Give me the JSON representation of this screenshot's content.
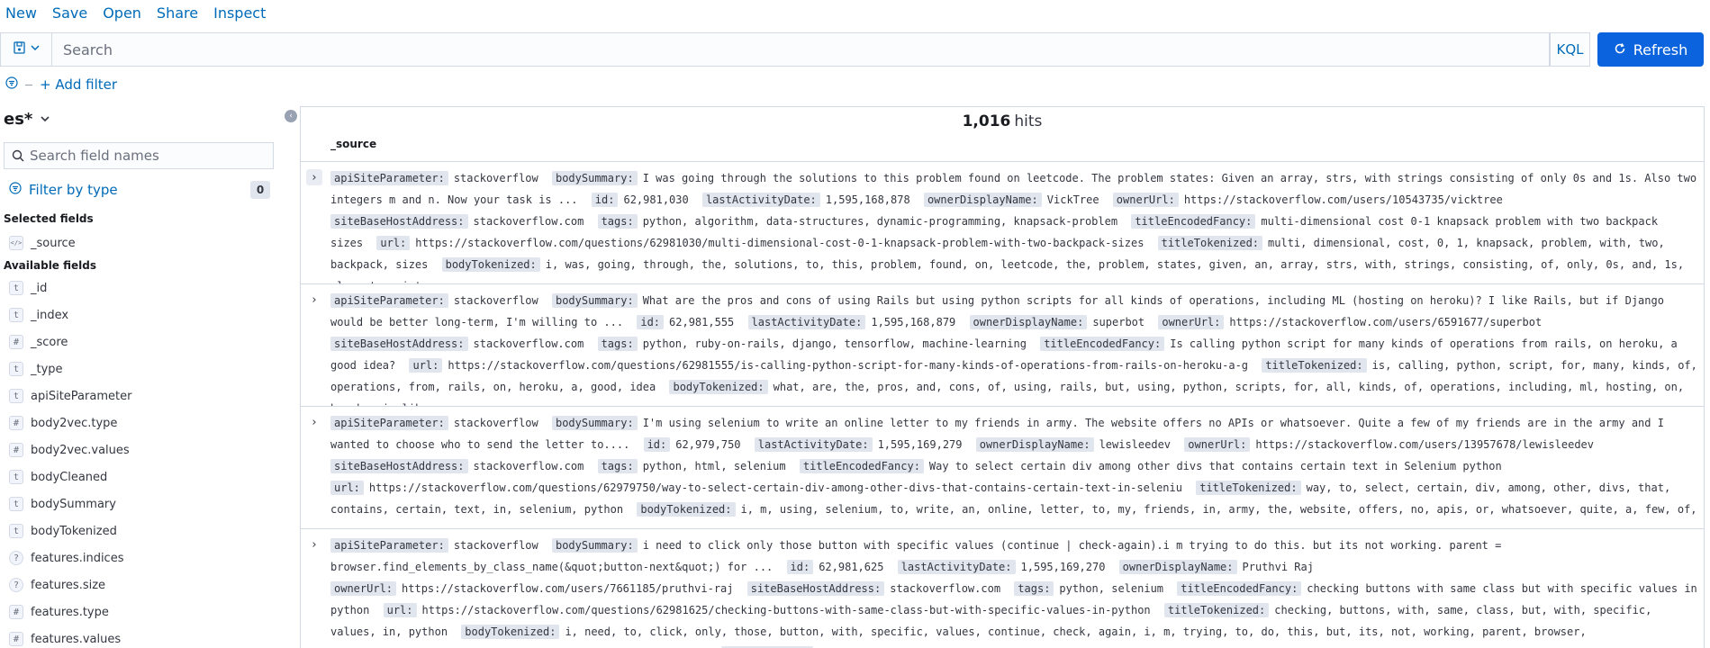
{
  "menu": {
    "new": "New",
    "save": "Save",
    "open": "Open",
    "share": "Share",
    "inspect": "Inspect"
  },
  "query": {
    "placeholder": "Search",
    "language": "KQL",
    "refresh_label": "Refresh"
  },
  "filters": {
    "add_label": "+ Add filter"
  },
  "sidebar": {
    "index_pattern": "es*",
    "field_search_placeholder": "Search field names",
    "filter_by_type_label": "Filter by type",
    "filter_count": "0",
    "selected_title": "Selected fields",
    "selected_fields": [
      {
        "type": "</>",
        "name": "_source"
      }
    ],
    "available_title": "Available fields",
    "available_fields": [
      {
        "type": "t",
        "name": "_id"
      },
      {
        "type": "t",
        "name": "_index"
      },
      {
        "type": "#",
        "name": "_score"
      },
      {
        "type": "t",
        "name": "_type"
      },
      {
        "type": "t",
        "name": "apiSiteParameter"
      },
      {
        "type": "#",
        "name": "body2vec.type"
      },
      {
        "type": "#",
        "name": "body2vec.values"
      },
      {
        "type": "t",
        "name": "bodyCleaned"
      },
      {
        "type": "t",
        "name": "bodySummary"
      },
      {
        "type": "t",
        "name": "bodyTokenized"
      },
      {
        "type": "?",
        "name": "features.indices"
      },
      {
        "type": "?",
        "name": "features.size"
      },
      {
        "type": "#",
        "name": "features.type"
      },
      {
        "type": "#",
        "name": "features.values"
      }
    ]
  },
  "results": {
    "hits_count": "1,016",
    "hits_label": "hits",
    "column_header": "_source",
    "docs": [
      [
        {
          "k": "apiSiteParameter:",
          "v": "stackoverflow"
        },
        {
          "k": "bodySummary:",
          "v": "I was going through the solutions to this problem found on leetcode. The problem states: Given an array, strs, with strings consisting of only 0s and 1s. Also two integers m and n. Now your task is ..."
        },
        {
          "k": "id:",
          "v": "62,981,030"
        },
        {
          "k": "lastActivityDate:",
          "v": "1,595,168,878"
        },
        {
          "k": "ownerDisplayName:",
          "v": "VickTree"
        },
        {
          "k": "ownerUrl:",
          "v": "https://stackoverflow.com/users/10543735/vicktree"
        },
        {
          "k": "siteBaseHostAddress:",
          "v": "stackoverflow.com"
        },
        {
          "k": "tags:",
          "v": "python, algorithm, data-structures, dynamic-programming, knapsack-problem"
        },
        {
          "k": "titleEncodedFancy:",
          "v": "multi-dimensional cost 0-1 knapsack problem with two backpack sizes"
        },
        {
          "k": "url:",
          "v": "https://stackoverflow.com/questions/62981030/multi-dimensional-cost-0-1-knapsack-problem-with-two-backpack-sizes"
        },
        {
          "k": "titleTokenized:",
          "v": "multi, dimensional, cost, 0, 1, knapsack, problem, with, two, backpack, sizes"
        },
        {
          "k": "bodyTokenized:",
          "v": "i, was, going, through, the, solutions, to, this, problem, found, on, leetcode, the, problem, states, given, an, array, strs, with, strings, consisting, of, only, 0s, and, 1s, also, two, integers,"
        }
      ],
      [
        {
          "k": "apiSiteParameter:",
          "v": "stackoverflow"
        },
        {
          "k": "bodySummary:",
          "v": "What are the pros and cons of using Rails but using python scripts for all kinds of operations, including ML (hosting on heroku)? I like Rails, but if Django would be better long-term, I'm willing to ..."
        },
        {
          "k": "id:",
          "v": "62,981,555"
        },
        {
          "k": "lastActivityDate:",
          "v": "1,595,168,879"
        },
        {
          "k": "ownerDisplayName:",
          "v": "superbot"
        },
        {
          "k": "ownerUrl:",
          "v": "https://stackoverflow.com/users/6591677/superbot"
        },
        {
          "k": "siteBaseHostAddress:",
          "v": "stackoverflow.com"
        },
        {
          "k": "tags:",
          "v": "python, ruby-on-rails, django, tensorflow, machine-learning"
        },
        {
          "k": "titleEncodedFancy:",
          "v": "Is calling python script for many kinds of operations from rails, on heroku, a good idea?"
        },
        {
          "k": "url:",
          "v": "https://stackoverflow.com/questions/62981555/is-calling-python-script-for-many-kinds-of-operations-from-rails-on-heroku-a-g"
        },
        {
          "k": "titleTokenized:",
          "v": "is, calling, python, script, for, many, kinds, of, operations, from, rails, on, heroku, a, good, idea"
        },
        {
          "k": "bodyTokenized:",
          "v": "what, are, the, pros, and, cons, of, using, rails, but, using, python, scripts, for, all, kinds, of, operations, including, ml, hosting, on, heroku, i, like,"
        }
      ],
      [
        {
          "k": "apiSiteParameter:",
          "v": "stackoverflow"
        },
        {
          "k": "bodySummary:",
          "v": "I'm using selenium to write an online letter to my friends in army. The website offers no APIs or whatsoever. Quite a few of my friends are in the army and I wanted to choose who to send the letter to...."
        },
        {
          "k": "id:",
          "v": "62,979,750"
        },
        {
          "k": "lastActivityDate:",
          "v": "1,595,169,279"
        },
        {
          "k": "ownerDisplayName:",
          "v": "lewisleedev"
        },
        {
          "k": "ownerUrl:",
          "v": "https://stackoverflow.com/users/13957678/lewisleedev"
        },
        {
          "k": "siteBaseHostAddress:",
          "v": "stackoverflow.com"
        },
        {
          "k": "tags:",
          "v": "python, html, selenium"
        },
        {
          "k": "titleEncodedFancy:",
          "v": "Way to select certain div among other divs that contains certain text in Selenium python"
        },
        {
          "k": "url:",
          "v": "https://stackoverflow.com/questions/62979750/way-to-select-certain-div-among-other-divs-that-contains-certain-text-in-seleniu"
        },
        {
          "k": "titleTokenized:",
          "v": "way, to, select, certain, div, among, other, divs, that, contains, certain, text, in, selenium, python"
        },
        {
          "k": "bodyTokenized:",
          "v": "i, m, using, selenium, to, write, an, online, letter, to, my, friends, in, army, the, website, offers, no, apis, or, whatsoever, quite, a, few, of, my,"
        }
      ],
      [
        {
          "k": "apiSiteParameter:",
          "v": "stackoverflow"
        },
        {
          "k": "bodySummary:",
          "v": "i need to click only those button with specific values (continue | check-again).i m trying to do this. but its not working. parent = browser.find_elements_by_class_name(&quot;button-next&quot;) for ..."
        },
        {
          "k": "id:",
          "v": "62,981,625"
        },
        {
          "k": "lastActivityDate:",
          "v": "1,595,169,270"
        },
        {
          "k": "ownerDisplayName:",
          "v": "Pruthvi Raj"
        },
        {
          "k": "ownerUrl:",
          "v": "https://stackoverflow.com/users/7661185/pruthvi-raj"
        },
        {
          "k": "siteBaseHostAddress:",
          "v": "stackoverflow.com"
        },
        {
          "k": "tags:",
          "v": "python, selenium"
        },
        {
          "k": "titleEncodedFancy:",
          "v": "checking buttons with same class but with specific values in python"
        },
        {
          "k": "url:",
          "v": "https://stackoverflow.com/questions/62981625/checking-buttons-with-same-class-but-with-specific-values-in-python"
        },
        {
          "k": "titleTokenized:",
          "v": "checking, buttons, with, same, class, but, with, specific, values, in, python"
        },
        {
          "k": "bodyTokenized:",
          "v": "i, need, to, click, only, those, button, with, specific, values, continue, check, again, i, m, trying, to, do, this, but, its, not, working, parent, browser, find_elements_by_class_name, quot, button, next, quot, for"
        },
        {
          "k": "titleCleaned:",
          "v": "checking, buttons,"
        }
      ]
    ]
  }
}
